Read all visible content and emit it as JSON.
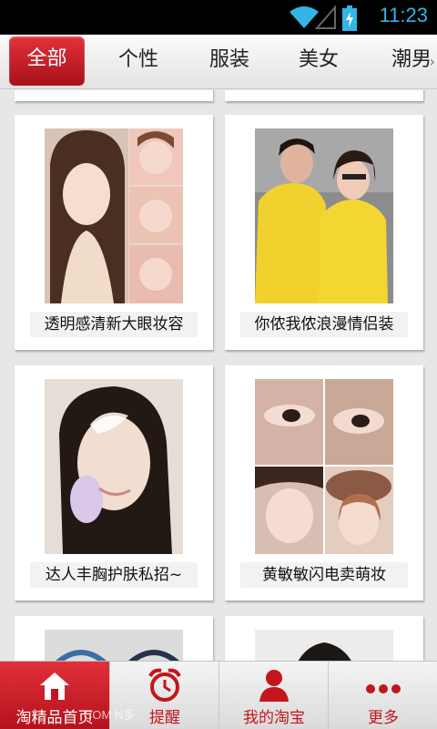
{
  "status_bar": {
    "time": "11:23"
  },
  "tabs": [
    {
      "label": "全部",
      "active": true
    },
    {
      "label": "个性",
      "active": false
    },
    {
      "label": "服装",
      "active": false
    },
    {
      "label": "美女",
      "active": false
    },
    {
      "label": "潮男",
      "active": false
    }
  ],
  "tabs_more_icon": "chevron-right-icon",
  "cards": [
    {
      "caption": "透明感清新大眼妆容"
    },
    {
      "caption": "你侬我侬浪漫情侣装"
    },
    {
      "caption": "达人丰胸护肤私招~"
    },
    {
      "caption": "黄敏敏闪电卖萌妆"
    }
  ],
  "bottom_nav": [
    {
      "label": "淘精品首页",
      "icon": "home-icon",
      "active": true
    },
    {
      "label": "提醒",
      "icon": "alarm-clock-icon",
      "active": false
    },
    {
      "label": "我的淘宝",
      "icon": "person-icon",
      "active": false
    },
    {
      "label": "更多",
      "icon": "more-dots-icon",
      "active": false
    }
  ],
  "watermark": "COM N多",
  "colors": {
    "accent": "#c3161c",
    "status_clock": "#33b5e5"
  }
}
